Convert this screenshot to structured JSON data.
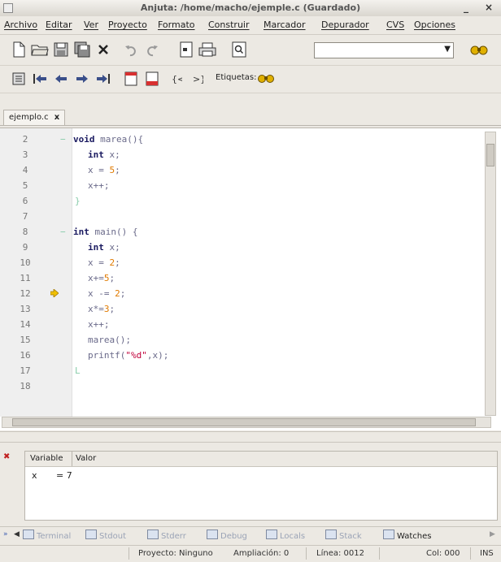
{
  "window": {
    "title": "Anjuta: /home/macho/ejemple.c (Guardado)",
    "minimize_glyph": "_",
    "close_glyph": "×"
  },
  "menu": [
    {
      "label": "Archivo"
    },
    {
      "label": "Editar"
    },
    {
      "label": "Ver"
    },
    {
      "label": "Proyecto"
    },
    {
      "label": "Formato"
    },
    {
      "label": "Construir"
    },
    {
      "label": "Marcador"
    },
    {
      "label": "Depurador"
    },
    {
      "label": "CVS"
    },
    {
      "label": "Opciones"
    }
  ],
  "toolbar2": {
    "tags_label": "Etiquetas:"
  },
  "editor": {
    "tab_label": "ejemplo.c",
    "tab_close": "x",
    "lines": [
      {
        "num": "2",
        "fold": "−"
      },
      {
        "num": "3"
      },
      {
        "num": "4"
      },
      {
        "num": "5"
      },
      {
        "num": "6",
        "fold": "}"
      },
      {
        "num": "7"
      },
      {
        "num": "8",
        "fold": "−"
      },
      {
        "num": "9"
      },
      {
        "num": "10"
      },
      {
        "num": "11"
      },
      {
        "num": "12"
      },
      {
        "num": "13"
      },
      {
        "num": "14"
      },
      {
        "num": "15"
      },
      {
        "num": "16"
      },
      {
        "num": "17",
        "fold": "L"
      },
      {
        "num": "18"
      }
    ],
    "code": {
      "l2_kw": "void",
      "l2_rest": " marea(){",
      "l3_kw": "int",
      "l3_rest": " x;",
      "l4_a": "x = ",
      "l4_num": "5",
      "l4_b": ";",
      "l5": "x++;",
      "l8_kw": "int",
      "l8_rest": " main() {",
      "l9_kw": "int",
      "l9_rest": " x;",
      "l10_a": "x = ",
      "l10_num": "2",
      "l10_b": ";",
      "l11_a": "x+=",
      "l11_num": "5",
      "l11_b": ";",
      "l12_a": "x -= ",
      "l12_num": "2",
      "l12_b": ";",
      "l13_a": "x*=",
      "l13_num": "3",
      "l13_b": ";",
      "l14": "x++;",
      "l15": "marea();",
      "l16_a": "printf(",
      "l16_str": "\"%d\"",
      "l16_b": ",x);"
    }
  },
  "watches": {
    "col_variable": "Variable",
    "col_value": "Valor",
    "rows": [
      {
        "variable": "x",
        "value": "= 7"
      }
    ]
  },
  "bottom_tabs": [
    {
      "label": "Terminal"
    },
    {
      "label": "Stdout"
    },
    {
      "label": "Stderr"
    },
    {
      "label": "Debug"
    },
    {
      "label": "Locals"
    },
    {
      "label": "Stack"
    },
    {
      "label": "Watches"
    }
  ],
  "status": {
    "project": "Proyecto: Ninguno",
    "zoom": "Ampliación: 0",
    "line": "Línea: 0012",
    "col": "Col: 000",
    "mode": "INS"
  },
  "colors": {
    "keyword": "#1a1a60",
    "number": "#e07a00",
    "string": "#c0003a",
    "breakpoint_arrow": "#f0c000"
  }
}
